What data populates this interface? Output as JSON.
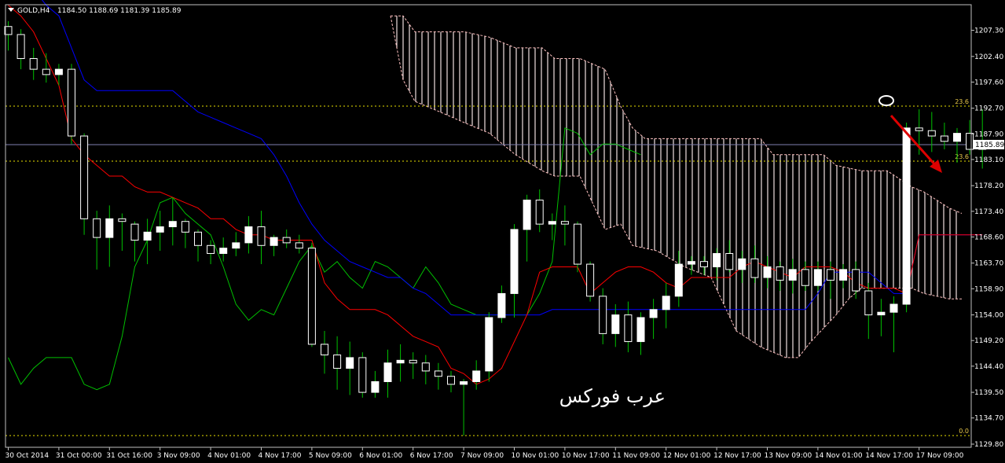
{
  "header": {
    "symbol_label": "GOLD,H4",
    "ohlc": "1184.50 1188.69 1181.39 1185.89"
  },
  "watermark": "عرب فوركس",
  "colors": {
    "background": "#000000",
    "frame": "#c0c0c0",
    "bull_candle": "#ffffff",
    "bear_candle": "#000000",
    "wick": "#00c000",
    "tenkan": "#ff0000",
    "kijun": "#0000ff",
    "chikou": "#00c000",
    "cloud_edge": "#ffc0c0",
    "cloud_hatch": "#f0e0e0",
    "fib_line": "#e8e000",
    "arrow": "#dd0000",
    "current_price_line": "#8080b0"
  },
  "icons": {
    "menu": "triangle-down-icon",
    "marker": "ellipse-marker-icon",
    "arrow": "down-right-arrow-icon"
  },
  "chart_data": {
    "type": "candlestick",
    "ylim": [
      1129.8,
      1209.9
    ],
    "y_ticks": [
      "1207.30",
      "1202.40",
      "1197.60",
      "1192.70",
      "1187.90",
      "1183.10",
      "1178.20",
      "1173.40",
      "1168.60",
      "1163.70",
      "1158.90",
      "1154.00",
      "1149.20",
      "1144.40",
      "1139.50",
      "1134.70",
      "1129.80"
    ],
    "y_tick_values": [
      1207.3,
      1202.4,
      1197.6,
      1192.7,
      1187.9,
      1183.1,
      1178.2,
      1173.4,
      1168.6,
      1163.7,
      1158.9,
      1154.0,
      1149.2,
      1144.4,
      1139.5,
      1134.7,
      1129.8
    ],
    "x_labels": [
      "30 Oct 2014",
      "31 Oct 00:00",
      "31 Oct 16:00",
      "3 Nov 09:00",
      "4 Nov 01:00",
      "4 Nov 17:00",
      "5 Nov 09:00",
      "6 Nov 01:00",
      "6 Nov 17:00",
      "7 Nov 09:00",
      "10 Nov 01:00",
      "10 Nov 17:00",
      "11 Nov 09:00",
      "12 Nov 01:00",
      "12 Nov 17:00",
      "13 Nov 09:00",
      "14 Nov 01:00",
      "14 Nov 17:00",
      "17 Nov 09:00"
    ],
    "x_label_bars": [
      0,
      4,
      8,
      12,
      16,
      20,
      24,
      28,
      32,
      36,
      40,
      44,
      48,
      52,
      56,
      60,
      64,
      68,
      72
    ],
    "current_price": 1185.89,
    "current_price_label": "1185.89",
    "fib_levels": [
      {
        "label": "23.6",
        "price": 1193.1
      },
      {
        "label": "23.6",
        "price": 1182.8
      },
      {
        "label": "0.0",
        "price": 1131.4
      }
    ],
    "candles": [
      [
        1208.0,
        1209.0,
        1203.5,
        1206.5
      ],
      [
        1206.5,
        1207.5,
        1200.0,
        1202.0
      ],
      [
        1202.0,
        1204.0,
        1198.0,
        1200.0
      ],
      [
        1200.0,
        1203.0,
        1197.5,
        1199.0
      ],
      [
        1199.0,
        1201.0,
        1197.0,
        1200.0
      ],
      [
        1200.0,
        1201.0,
        1186.0,
        1187.5
      ],
      [
        1187.5,
        1188.0,
        1169.0,
        1172.0
      ],
      [
        1172.0,
        1173.5,
        1162.5,
        1168.5
      ],
      [
        1168.5,
        1174.5,
        1163.0,
        1172.0
      ],
      [
        1172.0,
        1173.0,
        1166.0,
        1171.5
      ],
      [
        1171.0,
        1171.5,
        1164.0,
        1168.0
      ],
      [
        1168.0,
        1172.0,
        1163.5,
        1169.5
      ],
      [
        1169.5,
        1173.5,
        1166.0,
        1170.5
      ],
      [
        1170.5,
        1176.0,
        1167.0,
        1171.5
      ],
      [
        1171.5,
        1172.0,
        1166.5,
        1169.5
      ],
      [
        1169.5,
        1170.0,
        1164.0,
        1167.0
      ],
      [
        1167.0,
        1168.0,
        1163.5,
        1165.5
      ],
      [
        1165.5,
        1168.5,
        1164.0,
        1166.5
      ],
      [
        1166.5,
        1169.5,
        1165.0,
        1167.5
      ],
      [
        1167.5,
        1172.5,
        1165.5,
        1170.5
      ],
      [
        1170.5,
        1173.5,
        1163.5,
        1167.0
      ],
      [
        1167.0,
        1169.0,
        1165.0,
        1168.5
      ],
      [
        1168.5,
        1170.0,
        1166.5,
        1167.5
      ],
      [
        1167.5,
        1169.0,
        1165.5,
        1166.5
      ],
      [
        1166.5,
        1167.5,
        1148.0,
        1148.5
      ],
      [
        1148.5,
        1151.0,
        1143.0,
        1146.5
      ],
      [
        1146.5,
        1150.0,
        1140.0,
        1144.0
      ],
      [
        1144.0,
        1149.0,
        1139.0,
        1146.0
      ],
      [
        1146.0,
        1147.0,
        1138.5,
        1139.5
      ],
      [
        1139.5,
        1143.5,
        1138.5,
        1141.5
      ],
      [
        1141.5,
        1147.5,
        1138.5,
        1145.0
      ],
      [
        1145.0,
        1148.5,
        1141.5,
        1145.5
      ],
      [
        1145.5,
        1147.0,
        1142.0,
        1145.0
      ],
      [
        1145.0,
        1146.5,
        1141.0,
        1143.5
      ],
      [
        1143.5,
        1145.0,
        1140.0,
        1142.5
      ],
      [
        1142.5,
        1143.5,
        1139.5,
        1141.0
      ],
      [
        1141.0,
        1142.0,
        1131.4,
        1141.5
      ],
      [
        1141.5,
        1145.5,
        1140.0,
        1143.5
      ],
      [
        1143.5,
        1154.5,
        1141.5,
        1153.5
      ],
      [
        1153.5,
        1159.5,
        1152.5,
        1158.0
      ],
      [
        1158.0,
        1171.0,
        1153.5,
        1170.0
      ],
      [
        1170.0,
        1176.5,
        1164.0,
        1175.5
      ],
      [
        1175.5,
        1177.5,
        1169.5,
        1171.0
      ],
      [
        1171.0,
        1173.0,
        1168.0,
        1171.5
      ],
      [
        1171.5,
        1174.5,
        1167.0,
        1171.0
      ],
      [
        1171.0,
        1171.5,
        1162.0,
        1163.5
      ],
      [
        1163.5,
        1164.0,
        1156.5,
        1157.5
      ],
      [
        1157.5,
        1159.0,
        1148.5,
        1150.5
      ],
      [
        1150.5,
        1156.0,
        1148.0,
        1154.0
      ],
      [
        1154.0,
        1156.5,
        1147.0,
        1149.0
      ],
      [
        1149.0,
        1154.5,
        1146.5,
        1153.5
      ],
      [
        1153.5,
        1157.0,
        1149.5,
        1155.0
      ],
      [
        1155.0,
        1160.0,
        1151.5,
        1157.5
      ],
      [
        1157.5,
        1166.0,
        1155.5,
        1163.5
      ],
      [
        1163.5,
        1165.0,
        1161.5,
        1164.0
      ],
      [
        1164.0,
        1165.0,
        1161.5,
        1163.0
      ],
      [
        1163.0,
        1166.5,
        1160.5,
        1165.5
      ],
      [
        1165.5,
        1168.0,
        1162.0,
        1162.5
      ],
      [
        1162.5,
        1166.0,
        1160.0,
        1164.5
      ],
      [
        1164.5,
        1167.0,
        1160.0,
        1161.0
      ],
      [
        1161.0,
        1165.0,
        1159.0,
        1163.0
      ],
      [
        1163.0,
        1164.0,
        1158.5,
        1160.5
      ],
      [
        1160.5,
        1164.5,
        1158.0,
        1162.5
      ],
      [
        1162.5,
        1164.0,
        1158.5,
        1159.5
      ],
      [
        1159.5,
        1164.0,
        1158.5,
        1162.5
      ],
      [
        1162.5,
        1164.0,
        1157.0,
        1160.5
      ],
      [
        1160.5,
        1163.5,
        1159.0,
        1162.5
      ],
      [
        1162.5,
        1164.0,
        1157.0,
        1158.5
      ],
      [
        1158.5,
        1160.0,
        1149.5,
        1154.0
      ],
      [
        1154.0,
        1157.0,
        1150.0,
        1154.5
      ],
      [
        1154.5,
        1157.5,
        1147.0,
        1156.0
      ],
      [
        1156.0,
        1190.0,
        1154.5,
        1189.0
      ],
      [
        1189.0,
        1192.5,
        1184.0,
        1188.5
      ],
      [
        1188.5,
        1192.0,
        1184.5,
        1187.5
      ],
      [
        1187.5,
        1190.0,
        1185.0,
        1186.5
      ],
      [
        1186.5,
        1189.0,
        1182.5,
        1188.0
      ],
      [
        1188.0,
        1190.5,
        1184.0,
        1185.0
      ],
      [
        1185.0,
        1192.5,
        1181.4,
        1185.9
      ]
    ],
    "kijun": [
      1215,
      1215,
      1215,
      1212,
      1210,
      1204,
      1198,
      1196,
      1196,
      1196,
      1196,
      1196,
      1196,
      1196,
      1194,
      1192,
      1191,
      1190,
      1189,
      1188,
      1187,
      1184,
      1180,
      1175,
      1171,
      1168,
      1166,
      1164,
      1163,
      1162,
      1161,
      1161,
      1159,
      1158,
      1156,
      1154,
      1154,
      1154,
      1154,
      1154,
      1154,
      1154,
      1154,
      1155,
      1155,
      1155,
      1155,
      1155,
      1155,
      1155,
      1155,
      1155,
      1155,
      1155,
      1155,
      1155,
      1155,
      1155,
      1155,
      1155,
      1155,
      1155,
      1155,
      1155,
      1158,
      1162,
      1162,
      1162,
      1162,
      1160,
      1158,
      1158,
      1169,
      1169,
      1169,
      1169,
      1169,
      1169
    ],
    "tenkan": [
      1212,
      1210,
      1207,
      1202,
      1197,
      1187,
      1184,
      1182,
      1180,
      1180,
      1178,
      1177,
      1177,
      1176,
      1175,
      1174,
      1172,
      1172,
      1170,
      1169,
      1169,
      1168,
      1168,
      1168,
      1168,
      1160,
      1157,
      1155,
      1155,
      1155,
      1154,
      1152,
      1150,
      1149,
      1148,
      1144,
      1143,
      1141,
      1142,
      1144,
      1149,
      1154,
      1162,
      1163,
      1163,
      1163,
      1158,
      1160,
      1162,
      1163,
      1163,
      1162,
      1160,
      1159,
      1161,
      1161,
      1161,
      1161,
      1163,
      1164,
      1163,
      1162,
      1161,
      1163,
      1163,
      1163,
      1162,
      1160,
      1159,
      1159,
      1159,
      1158,
      1169,
      1169,
      1169,
      1169,
      1169,
      1169
    ],
    "chikou": [
      1146,
      1141,
      1144,
      1146,
      1146,
      1146,
      1141,
      1140,
      1141,
      1150,
      1163,
      1168,
      1175,
      1176,
      1173,
      1171,
      1169,
      1163,
      1156,
      1153,
      1155,
      1154,
      1159,
      1164,
      1167,
      1162,
      1164,
      1161,
      1159,
      1164,
      1163,
      1161,
      1159,
      1163,
      1160,
      1156,
      1155,
      1154,
      1154,
      1154,
      1154,
      1154,
      1158,
      1164,
      1189,
      1188,
      1184,
      1186,
      1186,
      1185,
      1184
    ]
  }
}
